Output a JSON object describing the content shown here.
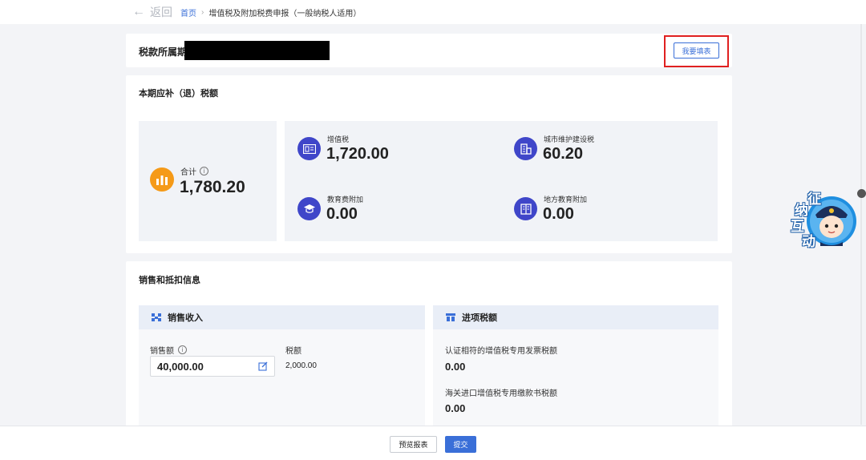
{
  "nav": {
    "back_label": "返回",
    "breadcrumb_home": "首页",
    "breadcrumb_current": "增值税及附加税费申报（一般纳税人适用）"
  },
  "period": {
    "label": "税款所属期",
    "fill_button": "我要填表"
  },
  "tax_summary": {
    "title": "本期应补（退）税额",
    "total_label": "合计",
    "total_value": "1,780.20",
    "items": [
      {
        "label": "增值税",
        "value": "1,720.00",
        "icon": "invoice-icon"
      },
      {
        "label": "城市维护建设税",
        "value": "60.20",
        "icon": "building-icon"
      },
      {
        "label": "教育费附加",
        "value": "0.00",
        "icon": "graduation-cap-icon"
      },
      {
        "label": "地方教育附加",
        "value": "0.00",
        "icon": "book-icon"
      }
    ]
  },
  "sales": {
    "title": "销售和抵扣信息",
    "revenue_panel": {
      "title": "销售收入",
      "amount_label": "销售额",
      "amount_value": "40,000.00",
      "tax_label": "税额",
      "tax_value": "2,000.00"
    },
    "input_panel": {
      "title": "进项税额",
      "certified_label": "认证相符的增值税专用发票税额",
      "certified_value": "0.00",
      "customs_label": "海关进口增值税专用缴款书税额",
      "customs_value": "0.00"
    }
  },
  "footer": {
    "preview_button": "预览报表",
    "submit_button": "提交"
  },
  "mascot": {
    "chars": [
      "征",
      "纳",
      "互",
      "动"
    ]
  },
  "colors": {
    "primary": "#3a6fd8",
    "highlight": "#e02020",
    "total_icon": "#f59a18",
    "item_icon": "#3f46c9"
  }
}
